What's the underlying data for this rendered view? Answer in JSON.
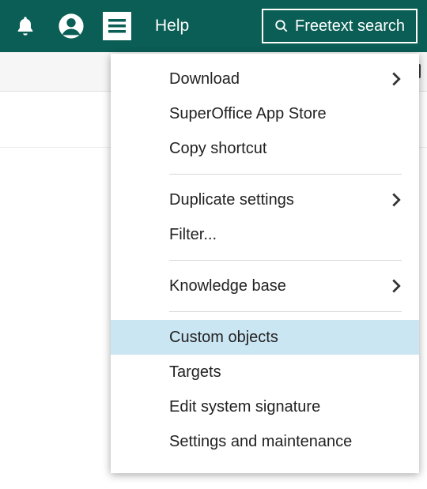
{
  "topbar": {
    "help_label": "Help",
    "search_label": "Freetext search"
  },
  "menu": {
    "group1": [
      {
        "label": "Download",
        "has_submenu": true
      },
      {
        "label": "SuperOffice App Store",
        "has_submenu": false
      },
      {
        "label": "Copy shortcut",
        "has_submenu": false
      }
    ],
    "group2": [
      {
        "label": "Duplicate settings",
        "has_submenu": true
      },
      {
        "label": "Filter...",
        "has_submenu": false
      }
    ],
    "group3": [
      {
        "label": "Knowledge base",
        "has_submenu": true
      }
    ],
    "group4": [
      {
        "label": "Custom objects",
        "has_submenu": false,
        "highlight": true
      },
      {
        "label": "Targets",
        "has_submenu": false
      },
      {
        "label": "Edit system signature",
        "has_submenu": false
      },
      {
        "label": "Settings and maintenance",
        "has_submenu": false
      }
    ]
  }
}
